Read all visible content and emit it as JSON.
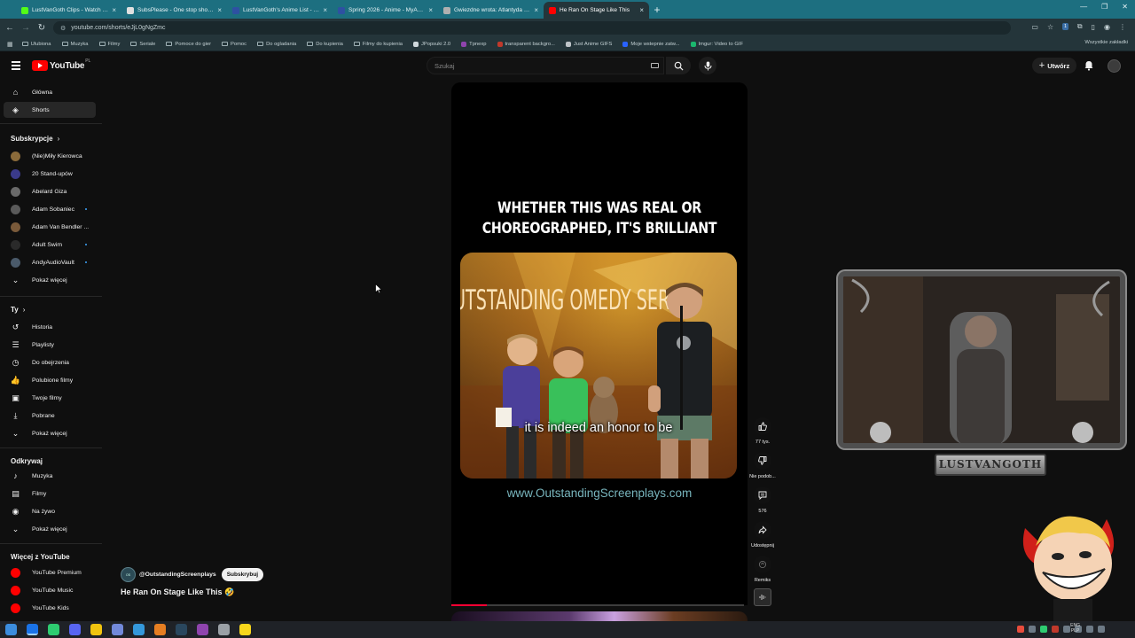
{
  "browser": {
    "tabs": [
      {
        "label": "LustVanGoth Clips - Watch Liv",
        "color": "#53fc18",
        "active": false
      },
      {
        "label": "SubsPlease - One stop shop fo",
        "color": "#e0e0e0",
        "active": false
      },
      {
        "label": "LustVanGoth's Anime List - My",
        "color": "#2e51a2",
        "active": false
      },
      {
        "label": "Spring 2026 - Anime - MyAnim",
        "color": "#2e51a2",
        "active": false
      },
      {
        "label": "Gwiezdne wrota: Atlantyda / St",
        "color": "#b0b0b0",
        "active": false
      },
      {
        "label": "He Ran On Stage Like This",
        "color": "#ff0000",
        "active": true
      }
    ],
    "url": "youtube.com/shorts/eJjL0gNgZmc",
    "bookmarks": [
      {
        "label": "Ulubiona",
        "kind": "folder"
      },
      {
        "label": "Muzyka",
        "kind": "folder"
      },
      {
        "label": "Filmy",
        "kind": "folder"
      },
      {
        "label": "Seriale",
        "kind": "folder"
      },
      {
        "label": "Pomoce do gier",
        "kind": "folder"
      },
      {
        "label": "Pomoc",
        "kind": "folder"
      },
      {
        "label": "Do ogladania",
        "kind": "folder"
      },
      {
        "label": "Do kupienia",
        "kind": "folder"
      },
      {
        "label": "Filmy do kupienia",
        "kind": "folder"
      },
      {
        "label": "JPopsuki 2.0",
        "kind": "site",
        "color": "#cfd8dc"
      },
      {
        "label": "Tpnexp",
        "kind": "site",
        "color": "#8e44ad"
      },
      {
        "label": "transparent backgro...",
        "kind": "site",
        "color": "#c0392b"
      },
      {
        "label": "Just Anime GIFS",
        "kind": "site",
        "color": "#bdc3c7"
      },
      {
        "label": "Moje wstepnie zatw...",
        "kind": "site",
        "color": "#2962ff"
      },
      {
        "label": "Imgur: Video to GIF",
        "kind": "site",
        "color": "#1bb76e"
      }
    ],
    "bookmarks_right": "Wszystkie zakładki"
  },
  "youtube": {
    "logo_text": "YouTube",
    "country": "PL",
    "search_placeholder": "Szukaj",
    "create_label": "Utwórz",
    "sidebar": {
      "main": [
        {
          "label": "Główna",
          "icon": "home-icon",
          "active": false
        },
        {
          "label": "Shorts",
          "icon": "shorts-icon",
          "active": true
        }
      ],
      "subscriptions_title": "Subskrypcje",
      "subscriptions": [
        {
          "label": "(Nie)Miły Kierowca",
          "color": "#8a6a3a",
          "dot": false
        },
        {
          "label": "20 Stand-upów",
          "color": "#3a3a8a",
          "dot": false
        },
        {
          "label": "Abelard Giza",
          "color": "#6a6a6a",
          "dot": false
        },
        {
          "label": "Adam Sobaniec",
          "color": "#5a5a5a",
          "dot": true
        },
        {
          "label": "Adam Van Bendler ...",
          "color": "#7a5a3a",
          "dot": false
        },
        {
          "label": "Adult Swim",
          "color": "#2a2a2a",
          "dot": true
        },
        {
          "label": "AndyAudioVault",
          "color": "#4a5a6a",
          "dot": true
        }
      ],
      "show_more": "Pokaż więcej",
      "you_title": "Ty",
      "you": [
        {
          "label": "Historia",
          "icon": "history-icon"
        },
        {
          "label": "Playlisty",
          "icon": "playlists-icon"
        },
        {
          "label": "Do obejrzenia",
          "icon": "watch-later-icon"
        },
        {
          "label": "Polubione filmy",
          "icon": "liked-videos-icon"
        },
        {
          "label": "Twoje filmy",
          "icon": "your-videos-icon"
        },
        {
          "label": "Pobrane",
          "icon": "downloads-icon"
        },
        {
          "label": "Pokaż więcej",
          "icon": "chevron-down-icon"
        }
      ],
      "explore_title": "Odkrywaj",
      "explore": [
        {
          "label": "Muzyka",
          "icon": "music-icon"
        },
        {
          "label": "Filmy",
          "icon": "movies-icon"
        },
        {
          "label": "Na żywo",
          "icon": "live-icon"
        },
        {
          "label": "Pokaż więcej",
          "icon": "chevron-down-icon"
        }
      ],
      "more_title": "Więcej z YouTube",
      "more": [
        {
          "label": "YouTube Premium",
          "color": "#ff0000"
        },
        {
          "label": "YouTube Music",
          "color": "#ff0000"
        },
        {
          "label": "YouTube Kids",
          "color": "#ff0000"
        }
      ]
    },
    "short": {
      "headline_line1": "WHETHER THIS WAS REAL OR",
      "headline_line2": "CHOREOGRAPHED, IT'S BRILLIANT",
      "stage_text": "UTSTANDING OMEDY SERI",
      "caption": "it is indeed an honor to be",
      "site_url": "www.OutstandingScreenplays.com",
      "progress": 0.12,
      "channel_handle": "@OutstandingScreenplays",
      "subscribe_label": "Subskrybuj",
      "title": "He Ran On Stage Like This 🤣"
    },
    "actions": {
      "likes": "77 tys.",
      "dislike": "Nie podob...",
      "comments": "576",
      "share": "Udostępnij",
      "remix": "Remiks"
    }
  },
  "overlay": {
    "cam_label": "LUSTVANGOTH"
  },
  "taskbar": {
    "lang_top": "ENG",
    "lang_bottom": "PLP",
    "apps": [
      "#1a73e8",
      "#2ecc71",
      "#5865f2",
      "#f1c40f",
      "#7289da",
      "#3498db",
      "#e67e22",
      "#2a475e",
      "#8e44ad",
      "#9aa0a6",
      "#f9d71c"
    ]
  }
}
